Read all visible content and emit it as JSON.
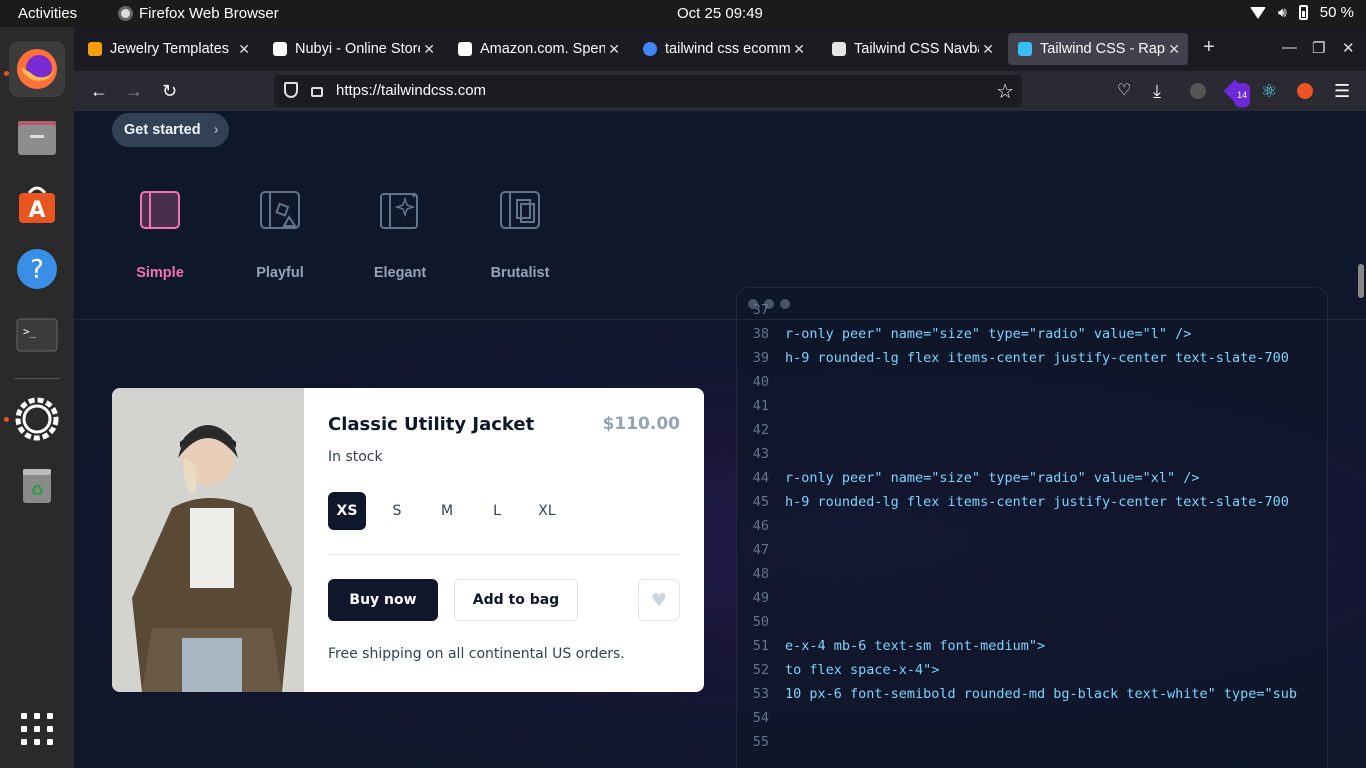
{
  "topbar": {
    "activities": "Activities",
    "app_name": "Firefox Web Browser",
    "clock": "Oct 25  09:49",
    "battery": "50 %"
  },
  "dock": {
    "items": [
      "Firefox",
      "Files",
      "Ubuntu Software",
      "Help",
      "Terminal",
      "Settings",
      "Trash"
    ],
    "apps_grid_icon": "grid-icon"
  },
  "tabs": [
    {
      "title": "Jewelry Templates",
      "favicon_color": "#f59e0b"
    },
    {
      "title": "Nubyi - Online Store",
      "favicon_color": "#ffffff"
    },
    {
      "title": "Amazon.com. Spend",
      "favicon_color": "#ffffff"
    },
    {
      "title": "tailwind css ecomm",
      "favicon_color": "#4285f4"
    },
    {
      "title": "Tailwind CSS Navba",
      "favicon_color": "#e5e5e5"
    },
    {
      "title": "Tailwind CSS - Rapid",
      "favicon_color": "#38bdf8"
    }
  ],
  "urlbar": {
    "url": "https://tailwindcss.com"
  },
  "extensions_badge": "14",
  "page": {
    "get_started": "Get started",
    "themes": [
      "Simple",
      "Playful",
      "Elegant",
      "Brutalist"
    ],
    "selected_theme": "Simple",
    "accent_color": "#f472b6"
  },
  "product": {
    "title": "Classic Utility Jacket",
    "price": "$110.00",
    "stock": "In stock",
    "sizes": [
      "XS",
      "S",
      "M",
      "L",
      "XL"
    ],
    "selected_size": "XS",
    "buy_label": "Buy now",
    "bag_label": "Add to bag",
    "shipping": "Free shipping on all continental US orders."
  },
  "code": {
    "lines": [
      {
        "n": "37",
        "t": ""
      },
      {
        "n": "38",
        "t": "r-only peer\" name=\"size\" type=\"radio\" value=\"l\" />"
      },
      {
        "n": "39",
        "t": " h-9 rounded-lg flex items-center justify-center text-slate-700"
      },
      {
        "n": "40",
        "t": ""
      },
      {
        "n": "41",
        "t": ""
      },
      {
        "n": "42",
        "t": ""
      },
      {
        "n": "43",
        "t": ""
      },
      {
        "n": "44",
        "t": "r-only peer\" name=\"size\" type=\"radio\" value=\"xl\" />"
      },
      {
        "n": "45",
        "t": " h-9 rounded-lg flex items-center justify-center text-slate-700"
      },
      {
        "n": "46",
        "t": ""
      },
      {
        "n": "47",
        "t": ""
      },
      {
        "n": "48",
        "t": ""
      },
      {
        "n": "49",
        "t": ""
      },
      {
        "n": "50",
        "t": ""
      },
      {
        "n": "51",
        "t": "e-x-4 mb-6 text-sm font-medium\">"
      },
      {
        "n": "52",
        "t": "to flex space-x-4\">"
      },
      {
        "n": "53",
        "t": "10 px-6 font-semibold rounded-md bg-black text-white\" type=\"sub"
      },
      {
        "n": "54",
        "t": ""
      },
      {
        "n": "55",
        "t": ""
      }
    ]
  }
}
